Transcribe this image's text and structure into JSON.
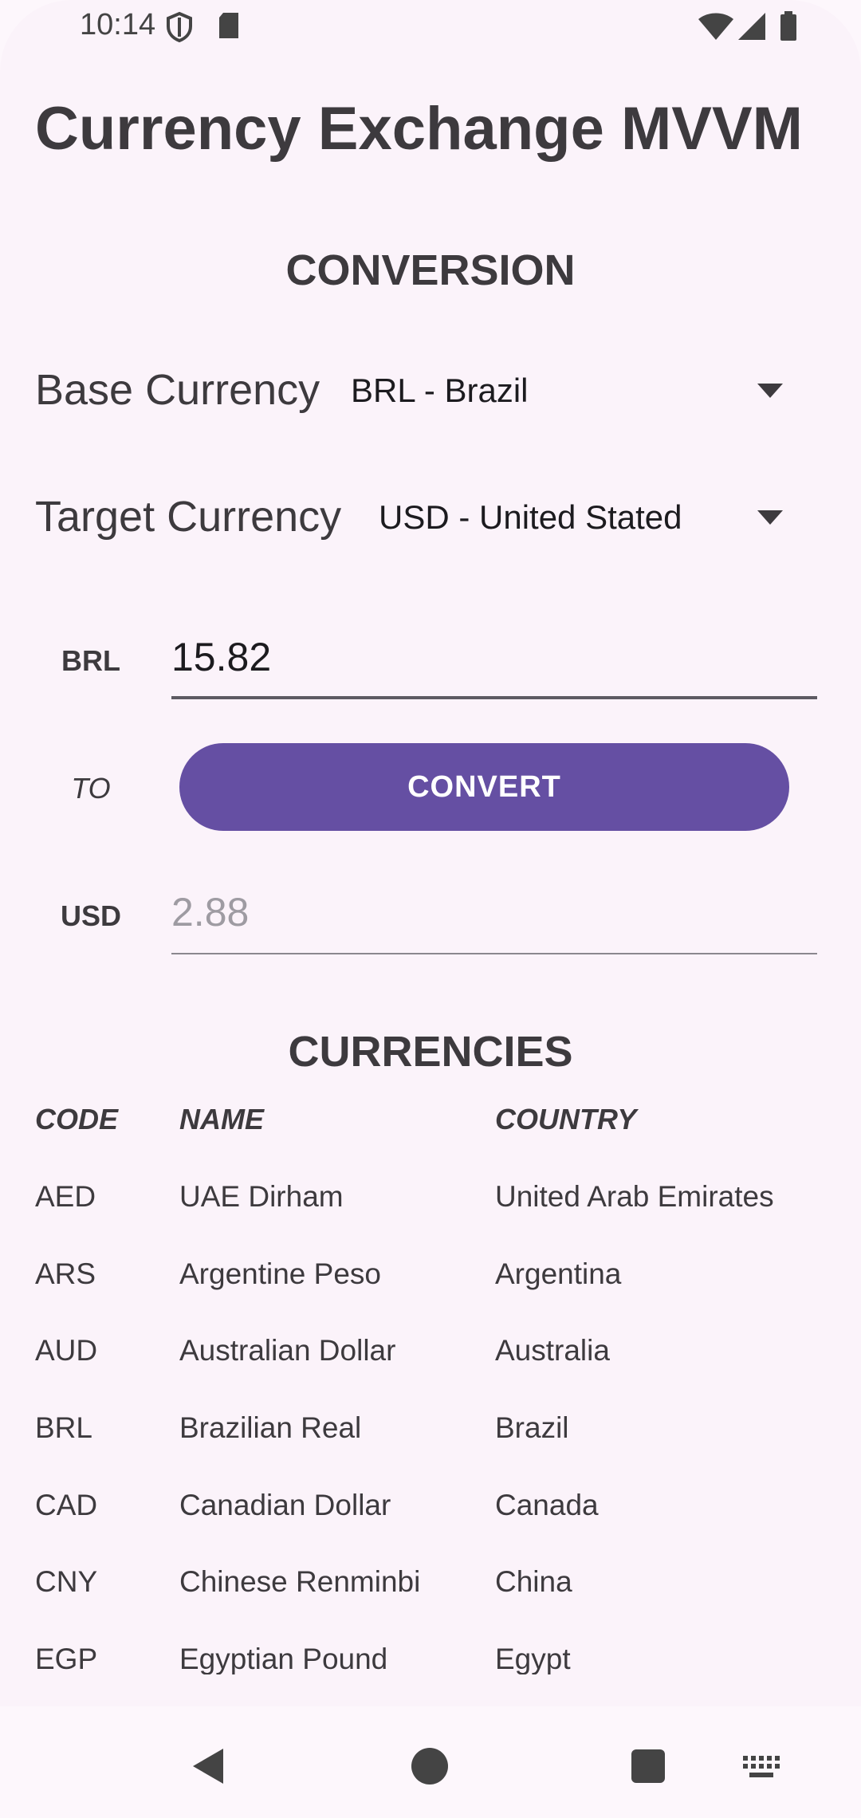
{
  "status_bar": {
    "time": "10:14",
    "icons": [
      "shield-icon",
      "sd-card-icon",
      "wifi-icon",
      "signal-icon",
      "battery-icon"
    ]
  },
  "app": {
    "title": "Currency Exchange MVVM"
  },
  "conversion": {
    "section_title": "CONVERSION",
    "base_label": "Base Currency",
    "base_value": "BRL - Brazil",
    "target_label": "Target Currency",
    "target_value": "USD - United Stated",
    "base_code": "BRL",
    "base_amount": "15.82",
    "to_label": "TO",
    "convert_label": "CONVERT",
    "target_code": "USD",
    "target_amount": "2.88"
  },
  "currencies": {
    "section_title": "CURRENCIES",
    "headers": {
      "code": "CODE",
      "name": "NAME",
      "country": "COUNTRY"
    },
    "rows": [
      {
        "code": "AED",
        "name": "UAE Dirham",
        "country": "United Arab Emirates"
      },
      {
        "code": "ARS",
        "name": "Argentine Peso",
        "country": "Argentina"
      },
      {
        "code": "AUD",
        "name": "Australian Dollar",
        "country": "Australia"
      },
      {
        "code": "BRL",
        "name": "Brazilian Real",
        "country": "Brazil"
      },
      {
        "code": "CAD",
        "name": "Canadian Dollar",
        "country": "Canada"
      },
      {
        "code": "CNY",
        "name": "Chinese Renminbi",
        "country": "China"
      },
      {
        "code": "EGP",
        "name": "Egyptian Pound",
        "country": "Egypt"
      }
    ]
  },
  "colors": {
    "accent": "#654fa3",
    "background": "#fbf3fa",
    "text": "#3d3a3e"
  },
  "nav_bar": {
    "icons": [
      "back-icon",
      "home-icon",
      "recents-icon",
      "keyboard-icon"
    ]
  }
}
